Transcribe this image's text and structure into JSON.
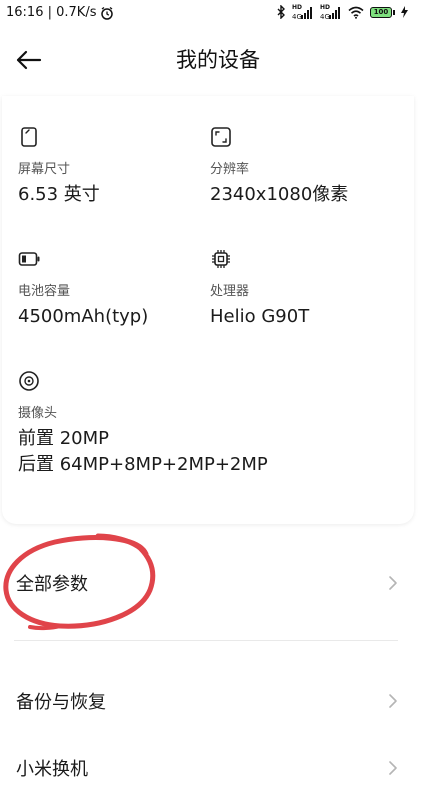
{
  "status_bar": {
    "time": "16:16",
    "speed": "0.7K/s",
    "battery": "100",
    "hd1": "HD",
    "hd2": "HD"
  },
  "header": {
    "title": "我的设备"
  },
  "specs": {
    "screen": {
      "icon": "phone-screen-icon",
      "label": "屏幕尺寸",
      "value": "6.53 英寸"
    },
    "resolution": {
      "icon": "resolution-frame-icon",
      "label": "分辨率",
      "value": "2340x1080像素"
    },
    "battery": {
      "icon": "battery-icon",
      "label": "电池容量",
      "value": "4500mAh(typ)"
    },
    "processor": {
      "icon": "chip-icon",
      "label": "处理器",
      "value": "Helio G90T"
    },
    "camera": {
      "icon": "camera-lens-icon",
      "label": "摄像头",
      "front": "前置 20MP",
      "rear": "后置 64MP+8MP+2MP+2MP"
    }
  },
  "menu": {
    "all_params": "全部参数",
    "backup": "备份与恢复",
    "migrate": "小米换机"
  },
  "colors": {
    "annotation": "#e0444a",
    "battery_fill": "#7ee07e"
  }
}
